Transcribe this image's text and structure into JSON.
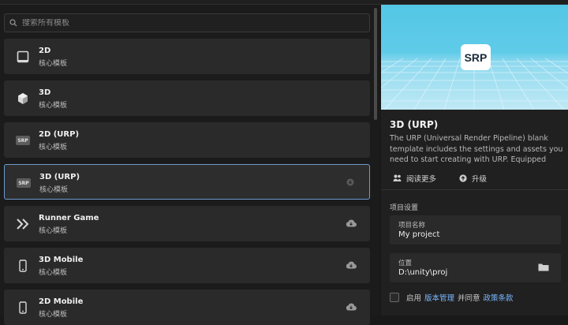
{
  "search": {
    "placeholder": "搜索所有模板"
  },
  "templates": [
    {
      "title": "2D",
      "subtitle": "核心模板",
      "icon": "square-icon",
      "download": false
    },
    {
      "title": "3D",
      "subtitle": "核心模板",
      "icon": "cube-icon",
      "download": false
    },
    {
      "title": "2D (URP)",
      "subtitle": "核心模板",
      "icon": "SRP",
      "download": false
    },
    {
      "title": "3D (URP)",
      "subtitle": "核心模板",
      "icon": "SRP",
      "download": true,
      "selected": true
    },
    {
      "title": "Runner Game",
      "subtitle": "核心模板",
      "icon": "chevrons-right-icon",
      "download": true
    },
    {
      "title": "3D Mobile",
      "subtitle": "核心模板",
      "icon": "phone-icon",
      "download": true
    },
    {
      "title": "2D Mobile",
      "subtitle": "核心模板",
      "icon": "phone-icon",
      "download": true
    }
  ],
  "detail": {
    "logo": "SRP",
    "title": "3D (URP)",
    "description": "The URP (Universal Render Pipeline) blank template includes the settings and assets you need to start creating with URP. Equipped wit...",
    "read_more": "阅读更多",
    "upgrade": "升级"
  },
  "settings": {
    "section_title": "项目设置",
    "project_name_label": "项目名称",
    "project_name_value": "My project",
    "location_label": "位置",
    "location_value": "D:\\unity\\proj"
  },
  "agreement": {
    "prefix": "启用",
    "link1": "版本管理",
    "middle": "并同意",
    "link2": "政策条款"
  }
}
